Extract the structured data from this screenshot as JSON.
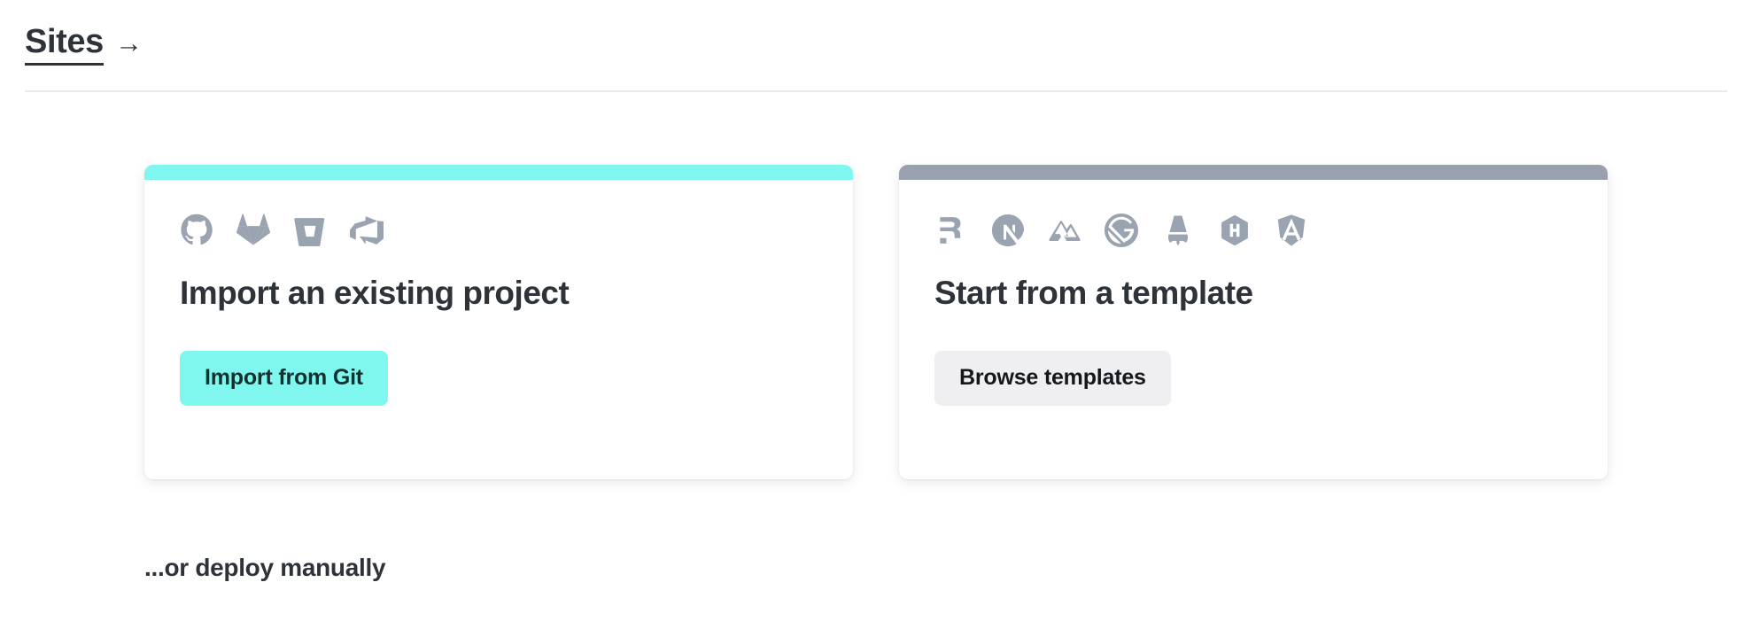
{
  "header": {
    "link_label": "Sites",
    "arrow_icon": "arrow-right-icon",
    "arrow_glyph": "→"
  },
  "colors": {
    "accent_teal": "#7ff7ef",
    "accent_gray": "#99a1ae",
    "text_dark": "#2e3339",
    "button_secondary_bg": "#efeff1",
    "icon_gray": "#9aa3b0",
    "divider": "#e9eaec"
  },
  "cards": [
    {
      "accent": "teal",
      "title": "Import an existing project",
      "cta_label": "Import from Git",
      "icons": [
        {
          "name": "github-icon",
          "label": "GitHub"
        },
        {
          "name": "gitlab-icon",
          "label": "GitLab"
        },
        {
          "name": "bitbucket-icon",
          "label": "Bitbucket"
        },
        {
          "name": "azure-devops-icon",
          "label": "Azure DevOps"
        }
      ]
    },
    {
      "accent": "gray",
      "title": "Start from a template",
      "cta_label": "Browse templates",
      "icons": [
        {
          "name": "remix-icon",
          "label": "Remix"
        },
        {
          "name": "nextjs-icon",
          "label": "Next.js"
        },
        {
          "name": "nuxt-icon",
          "label": "Nuxt"
        },
        {
          "name": "gatsby-icon",
          "label": "Gatsby"
        },
        {
          "name": "astro-icon",
          "label": "Astro"
        },
        {
          "name": "hugo-icon",
          "label": "Hugo"
        },
        {
          "name": "angular-icon",
          "label": "Angular"
        }
      ]
    }
  ],
  "footer": {
    "manual_note": "...or deploy manually"
  }
}
